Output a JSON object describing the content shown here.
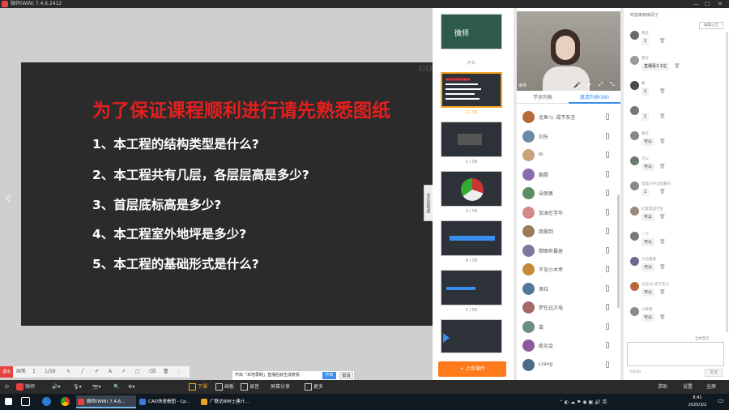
{
  "window": {
    "title": "微师(WIN) 7.4.6.2412"
  },
  "slide": {
    "watermark": "GO",
    "title": "为了保证课程顺利进行请先熟悉图纸",
    "questions": [
      "1、本工程的结构类型是什么?",
      "2、本工程共有几层，各层层高是多少?",
      "3、首层底标高是多少?",
      "4、本工程室外地坪是多少?",
      "5、本工程的基础形式是什么?"
    ],
    "collapse_label": "收起缩略图"
  },
  "annotation_bar": {
    "exit": "退出",
    "items": [
      "画笔",
      "1",
      "1/58"
    ]
  },
  "thumbnails": {
    "items": [
      {
        "label": "片头",
        "caption": "微师"
      },
      {
        "label": "2 / 58"
      },
      {
        "label": "2 / 58"
      },
      {
        "label": "3 / 58"
      },
      {
        "label": "4 / 58"
      },
      {
        "label": "5 / 58"
      },
      {
        "label": ""
      }
    ],
    "add_button": "+ 上传课件"
  },
  "hint": {
    "text": "开启「本地录制」直播后就生成复看",
    "on": "开启",
    "off": "取消"
  },
  "users": {
    "tabs": [
      "学员列表",
      "邀请列表(98)"
    ],
    "list": [
      {
        "name": "北鱼🐚 成不及言",
        "color": "#b56a3c"
      },
      {
        "name": "刘东",
        "color": "#6d8aa8"
      },
      {
        "name": "lo",
        "color": "#c9a37a"
      },
      {
        "name": "朝霞",
        "color": "#8a6bb0"
      },
      {
        "name": "朵颜奥",
        "color": "#5f8c63"
      },
      {
        "name": "加油在学华",
        "color": "#d08a8a"
      },
      {
        "name": "我做到",
        "color": "#9a7b5a"
      },
      {
        "name": "穆图有暴居",
        "color": "#7a7a9c"
      },
      {
        "name": "不见小木亭",
        "color": "#c48a3a"
      },
      {
        "name": "涿拉",
        "color": "#557799"
      },
      {
        "name": "梦在远方电",
        "color": "#a46a6a"
      },
      {
        "name": "葛",
        "color": "#6b8f7c"
      },
      {
        "name": "绝见金",
        "color": "#8a5a9a"
      },
      {
        "name": "Lrang",
        "color": "#4d6a8a"
      }
    ]
  },
  "video": {
    "name": "讲师",
    "controls": [
      "🎤",
      "⟳",
      "⤢",
      "⤡"
    ]
  },
  "chat": {
    "header": "欢迎来到房间了",
    "notice_button": "编辑公告",
    "messages": [
      {
        "name": "我在",
        "text": "1",
        "color": "#6b6b6b"
      },
      {
        "name": "我在",
        "text": "直播看3.1位",
        "color": "#9a9a9a"
      },
      {
        "name": "看",
        "text": "1",
        "color": "#4a4a4a"
      },
      {
        "name": "",
        "text": "1",
        "color": "#777777"
      },
      {
        "name": "我在",
        "text": "可以",
        "color": "#888888"
      },
      {
        "name": "可以",
        "text": "可以",
        "color": "#6c7a6c"
      },
      {
        "name": "程晨冷卉太极蒙码",
        "text": "1",
        "color": "#8a8a8a"
      },
      {
        "name": "红雷漫漫学生",
        "text": "可以",
        "color": "#9a8a7a"
      },
      {
        "name": "一七",
        "text": "可以",
        "color": "#7a7a7a"
      },
      {
        "name": "头位雷蒙",
        "text": "可以",
        "color": "#6a6a8a"
      },
      {
        "name": "北鱼🐚 成不及言",
        "text": "可以",
        "color": "#b56a3c"
      },
      {
        "name": "小神雷",
        "text": "可以",
        "color": "#8a8a8a"
      }
    ],
    "option_label": "全体禁言",
    "counter": "0/140",
    "send_label": "发送"
  },
  "bottom_bar": {
    "logo": "微师",
    "items": [
      "下课",
      "画板",
      "录音",
      "屏幕分享",
      "更多"
    ],
    "right_items": [
      "求助",
      "设置",
      "全屏"
    ]
  },
  "taskbar": {
    "apps": [
      {
        "label": "微师(WIN) 7.4.6...",
        "color": "#e64340"
      },
      {
        "label": "CAD快速看图 - Cp...",
        "color": "#3b7be0"
      },
      {
        "label": "广联达BIM土建计...",
        "color": "#f0a020"
      }
    ],
    "time": "8:41",
    "date": "2020/3/2"
  }
}
